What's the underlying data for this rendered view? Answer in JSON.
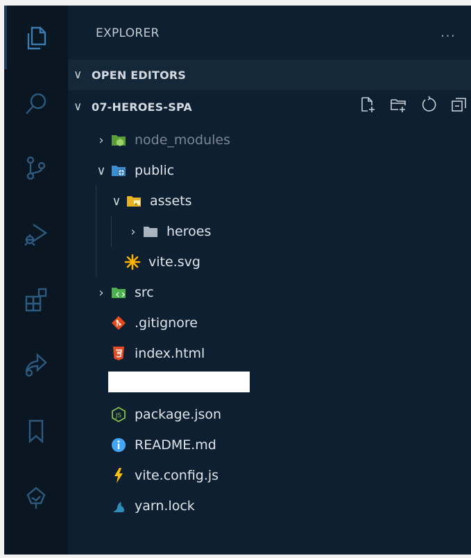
{
  "sidebar": {
    "title": "EXPLORER",
    "more_label": "...",
    "open_editors_label": "OPEN EDITORS",
    "project_label": "07-HEROES-SPA"
  },
  "tree": [
    {
      "name": "node_modules",
      "type": "folder",
      "icon": "folder-node-icon"
    },
    {
      "name": "public",
      "type": "folder",
      "icon": "folder-public-icon"
    },
    {
      "name": "assets",
      "type": "folder",
      "icon": "folder-assets-icon"
    },
    {
      "name": "heroes",
      "type": "folder",
      "icon": "folder-icon"
    },
    {
      "name": "vite.svg",
      "type": "file",
      "icon": "svg-file-icon"
    },
    {
      "name": "src",
      "type": "folder",
      "icon": "folder-src-icon"
    },
    {
      "name": ".gitignore",
      "type": "file",
      "icon": "git-icon"
    },
    {
      "name": "index.html",
      "type": "file",
      "icon": "html5-icon"
    },
    {
      "name": "",
      "type": "redacted",
      "icon": ""
    },
    {
      "name": "package.json",
      "type": "file",
      "icon": "nodejs-icon"
    },
    {
      "name": "README.md",
      "type": "file",
      "icon": "info-icon"
    },
    {
      "name": "vite.config.js",
      "type": "file",
      "icon": "vite-icon"
    },
    {
      "name": "yarn.lock",
      "type": "file",
      "icon": "yarn-icon"
    }
  ],
  "colors": {
    "background": "#0b1a29",
    "sidebar": "#0d1f30",
    "activity_bar": "#0a1622",
    "text": "#dfe5ea",
    "dim_text": "#7b8794",
    "icon_stroke": "#2d5b80"
  }
}
